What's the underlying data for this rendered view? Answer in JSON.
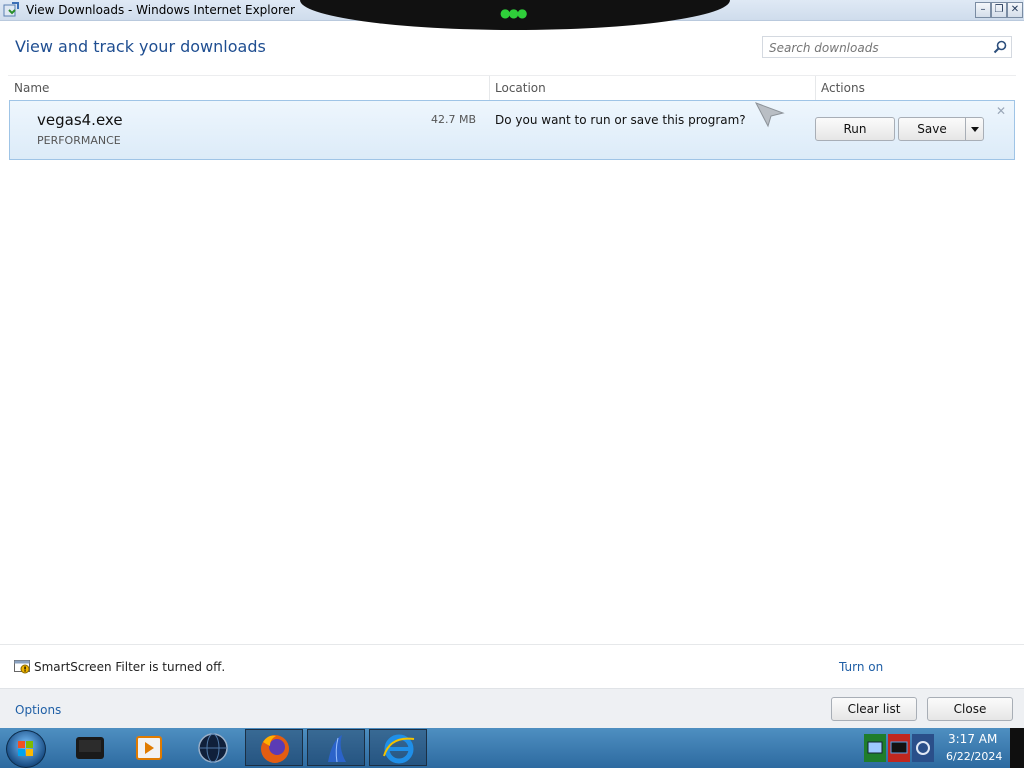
{
  "window": {
    "title": "View Downloads - Windows Internet Explorer",
    "controls": {
      "minimize": "–",
      "restore": "❐",
      "close": "✕"
    }
  },
  "header": {
    "title": "View and track your downloads",
    "search_placeholder": "Search downloads",
    "search_icon": "search-icon"
  },
  "columns": {
    "name": "Name",
    "location": "Location",
    "actions": "Actions"
  },
  "downloads": [
    {
      "filename": "vegas4.exe",
      "size": "42.7 MB",
      "publisher": "PERFORMANCE",
      "prompt": "Do you want to run or save this program?",
      "run_label": "Run",
      "save_label": "Save",
      "dismiss": "✕"
    }
  ],
  "smartscreen": {
    "message": "SmartScreen Filter is turned off.",
    "link": "Turn on"
  },
  "footer": {
    "options_link": "Options",
    "clear_label": "Clear list",
    "close_label": "Close"
  },
  "taskbar": {
    "items": [
      "media-center-icon",
      "media-player-icon",
      "browser-globe-icon",
      "firefox-icon",
      "feather-app-icon",
      "internet-explorer-icon"
    ],
    "tray": {
      "time": "3:17 AM",
      "date": "6/22/2024"
    }
  },
  "colors": {
    "accent": "#1f4e91",
    "link": "#1f5fa6",
    "row_bg": "#e5f0fb",
    "row_border": "#9fc4e6"
  }
}
